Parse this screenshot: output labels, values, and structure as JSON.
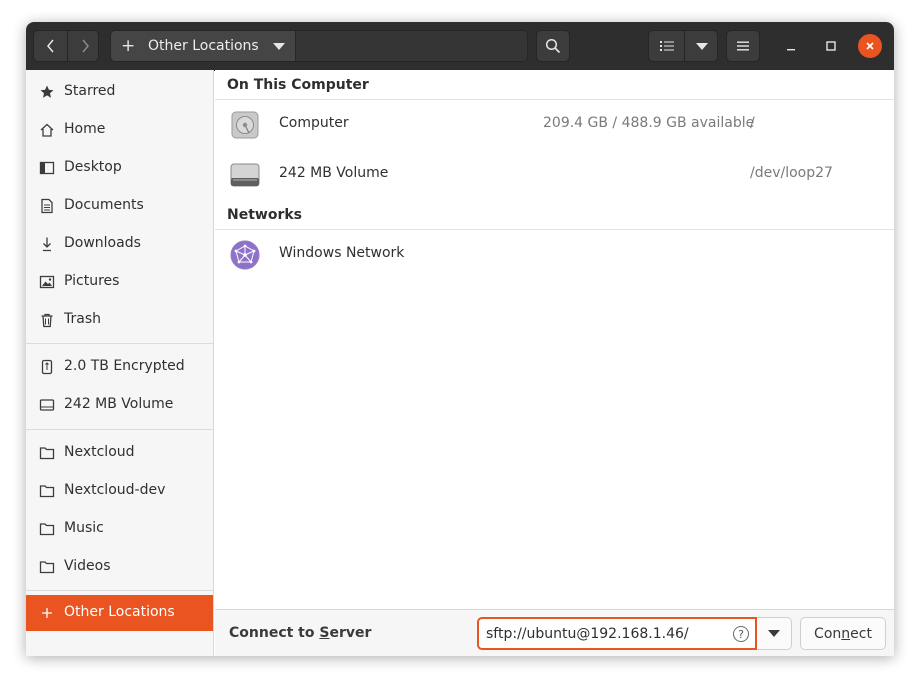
{
  "header": {
    "path_label": "Other Locations",
    "back_icon": "chevron-left-icon",
    "forward_icon": "chevron-right-icon"
  },
  "sidebar": {
    "items": [
      {
        "label": "Starred",
        "icon": "star-icon"
      },
      {
        "label": "Home",
        "icon": "home-icon"
      },
      {
        "label": "Desktop",
        "icon": "desktop-icon"
      },
      {
        "label": "Documents",
        "icon": "document-icon"
      },
      {
        "label": "Downloads",
        "icon": "download-icon"
      },
      {
        "label": "Pictures",
        "icon": "picture-icon"
      },
      {
        "label": "Trash",
        "icon": "trash-icon"
      }
    ],
    "devices": [
      {
        "label": "2.0 TB Encrypted",
        "icon": "usb-drive-icon"
      },
      {
        "label": "242 MB Volume",
        "icon": "drive-icon"
      }
    ],
    "bookmarks": [
      {
        "label": "Nextcloud",
        "icon": "folder-icon"
      },
      {
        "label": "Nextcloud-dev",
        "icon": "folder-icon"
      },
      {
        "label": "Music",
        "icon": "folder-icon"
      },
      {
        "label": "Videos",
        "icon": "folder-icon"
      }
    ],
    "other_locations": {
      "label": "Other Locations",
      "icon": "plus-icon"
    }
  },
  "main": {
    "on_this_computer": {
      "heading": "On This Computer",
      "rows": [
        {
          "name": "Computer",
          "space": "209.4 GB / 488.9 GB available",
          "path": "/"
        },
        {
          "name": "242 MB Volume",
          "space": "",
          "path": "/dev/loop27"
        }
      ]
    },
    "networks": {
      "heading": "Networks",
      "rows": [
        {
          "name": "Windows Network"
        }
      ]
    }
  },
  "connect": {
    "label_prefix": "Connect to ",
    "label_mnemonic": "S",
    "label_rest": "erver",
    "address_value": "sftp://ubuntu@192.168.1.46/",
    "help_glyph": "?",
    "button_prefix": "Con",
    "button_mnemonic": "n",
    "button_rest": "ect"
  },
  "colors": {
    "accent": "#e95420",
    "headerbar": "#2e2e2e",
    "sidebar": "#f6f6f6"
  }
}
